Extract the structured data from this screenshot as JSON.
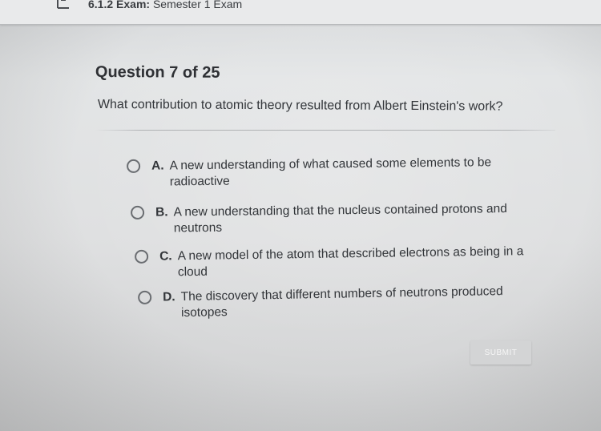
{
  "header": {
    "course_code": "6.1.2",
    "exam_label": "Exam:",
    "exam_name": "Semester 1 Exam"
  },
  "question": {
    "progress": "Question 7 of 25",
    "text": "What contribution to atomic theory resulted from Albert Einstein's work?",
    "options": [
      {
        "letter": "A.",
        "text": "A new understanding of what caused some elements to be radioactive",
        "selected": false
      },
      {
        "letter": "B.",
        "text": "A new understanding that the nucleus contained protons and neutrons",
        "selected": false
      },
      {
        "letter": "C.",
        "text": "A new model of the atom that described electrons as being in a cloud",
        "selected": false
      },
      {
        "letter": "D.",
        "text": "The discovery that different numbers of neutrons produced isotopes",
        "selected": false
      }
    ]
  },
  "actions": {
    "submit_label": "SUBMIT"
  },
  "icons": {
    "menu": "menu-icon"
  },
  "colors": {
    "page_background": "#dfe0e1",
    "submit_disabled": "#d3d4d5"
  }
}
